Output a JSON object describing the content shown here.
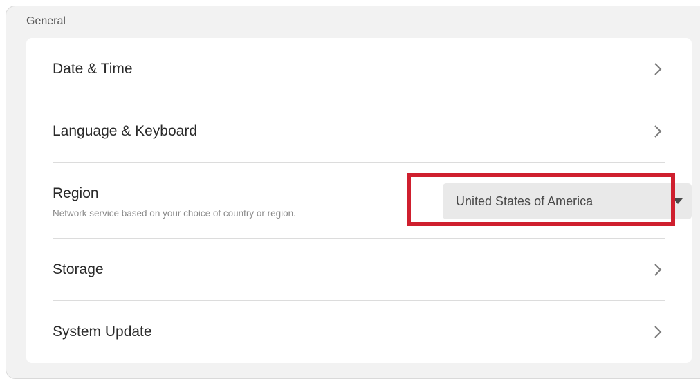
{
  "section": {
    "title": "General"
  },
  "rows": [
    {
      "label": "Date & Time",
      "icon": "chevron-right-icon"
    },
    {
      "label": "Language & Keyboard",
      "icon": "chevron-right-icon"
    },
    {
      "label": "Region",
      "subtitle": "Network service based on your choice of country or region.",
      "dropdown": {
        "value": "United States of America",
        "icon": "caret-down-icon"
      }
    },
    {
      "label": "Storage",
      "icon": "chevron-right-icon"
    },
    {
      "label": "System Update",
      "icon": "chevron-right-icon"
    }
  ],
  "colors": {
    "panel_bg": "#f2f2f2",
    "card_bg": "#ffffff",
    "text_primary": "#2a2a2a",
    "text_secondary": "#8a8a8a",
    "dropdown_bg": "#e9e9e9",
    "highlight": "#cf1f2e"
  }
}
